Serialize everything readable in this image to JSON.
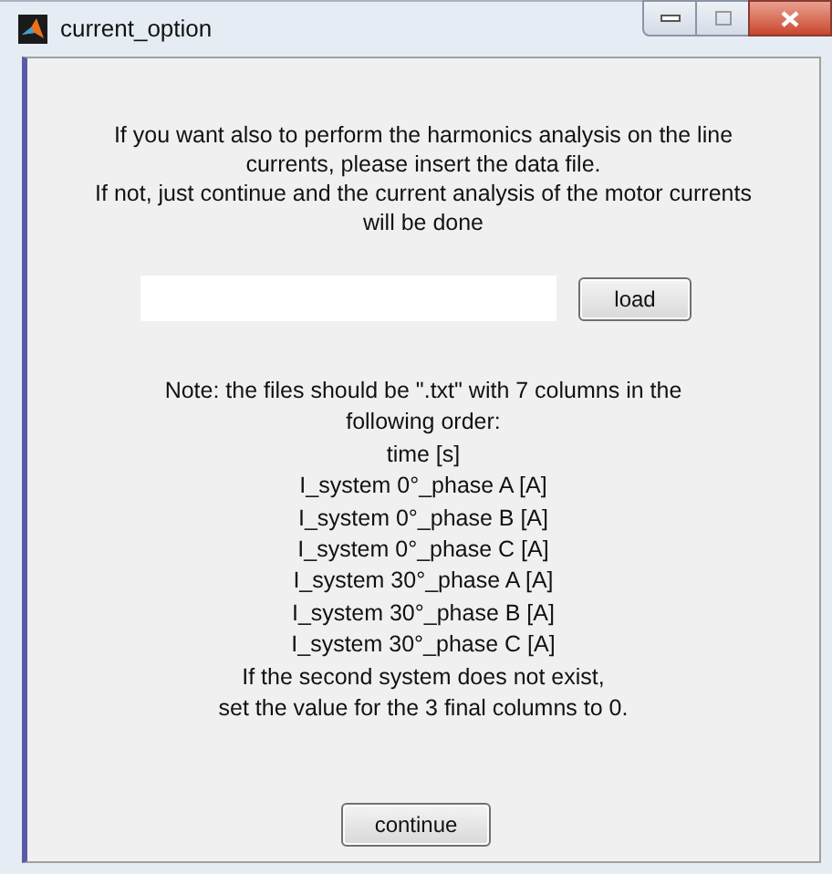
{
  "window": {
    "title": "current_option"
  },
  "intro": [
    "If you want also to perform the harmonics analysis on the line",
    "currents, please insert the data file.",
    "If not, just continue and the current analysis of the motor currents",
    "will be done"
  ],
  "load_button": {
    "label": "load"
  },
  "note": [
    "Note: the files should be \".txt\" with 7 columns in the",
    "following order:",
    "time [s]",
    "I_system 0°_phase A [A]",
    "I_system 0°_phase B [A]",
    "I_system 0°_phase C [A]",
    "I_system 30°_phase A [A]",
    "I_system 30°_phase B [A]",
    "I_system 30°_phase C [A]",
    "If the second system does not exist,",
    "set the value for the 3 final columns to 0."
  ],
  "continue_button": {
    "label": "continue"
  }
}
